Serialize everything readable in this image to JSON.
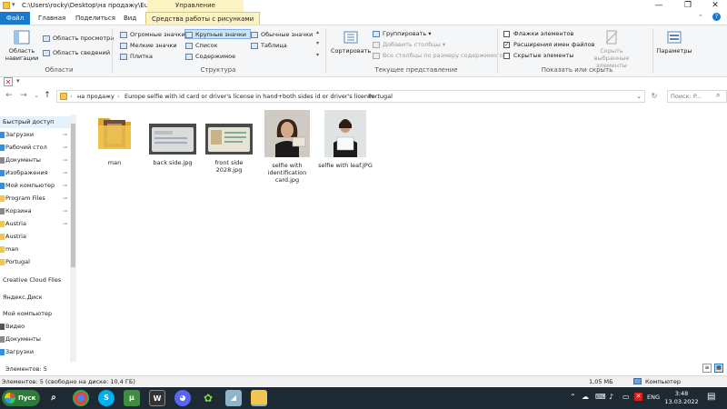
{
  "window": {
    "title": "C:\\Users\\rocky\\Desktop\\на продажу\\Europe...",
    "manage_label": "Управление",
    "minimize": "—",
    "maximize": "❐",
    "close": "✕"
  },
  "tabs": {
    "file": "Файл",
    "home": "Главная",
    "share": "Поделиться",
    "view": "Вид",
    "picture_tools": "Средства работы с рисунками"
  },
  "ribbon": {
    "areas": {
      "nav_pane": "Область навигации",
      "preview": "Область просмотра",
      "details": "Область сведений",
      "group_label": "Области"
    },
    "layout": {
      "huge": "Огромные значки",
      "large": "Крупные значки",
      "normal": "Обычные значки",
      "small": "Мелкие значки",
      "list": "Список",
      "table": "Таблица",
      "tiles": "Плитка",
      "content": "Содержимое",
      "group_label": "Структура"
    },
    "view": {
      "sort": "Сортировать",
      "group_by": "Группировать",
      "add_columns": "Добавить столбцы",
      "fit_columns": "Все столбцы по размеру содержимого",
      "group_label": "Текущее представление"
    },
    "show": {
      "checkboxes": "Флажки элементов",
      "extensions": "Расширения имен файлов",
      "hidden": "Скрытые элементы",
      "hide_selected": "Скрыть выбранные элементы",
      "group_label": "Показать или скрыть"
    },
    "options": "Параметры"
  },
  "address": {
    "crumbs": [
      "на продажу",
      "Europe selfie with id card or driver's license in hand+both sides id or driver's license",
      "Portugal"
    ],
    "separator": "›",
    "search_placeholder": "Поиск: P..."
  },
  "sidebar": {
    "items": [
      {
        "label": "Быстрый доступ",
        "pinned": false
      },
      {
        "label": "Загрузки",
        "pinned": true
      },
      {
        "label": "Рабочий стол",
        "pinned": true
      },
      {
        "label": "Документы",
        "pinned": true
      },
      {
        "label": "Изображения",
        "pinned": true
      },
      {
        "label": "Мой компьютер",
        "pinned": true
      },
      {
        "label": "Program Files",
        "pinned": true
      },
      {
        "label": "Корзина",
        "pinned": true
      },
      {
        "label": "Austria",
        "pinned": true
      },
      {
        "label": "Austria",
        "pinned": false
      },
      {
        "label": "man",
        "pinned": false
      },
      {
        "label": "Portugal",
        "pinned": false
      },
      {
        "label": "Creative Cloud Files",
        "pinned": false
      },
      {
        "label": "Яндекс.Диск",
        "pinned": false
      },
      {
        "label": "Мой компьютер",
        "pinned": false
      },
      {
        "label": "Видео",
        "pinned": false
      },
      {
        "label": "Документы",
        "pinned": false
      },
      {
        "label": "Загрузки",
        "pinned": false
      }
    ]
  },
  "files": [
    {
      "name": "man",
      "kind": "folder"
    },
    {
      "name": "back side.jpg",
      "kind": "id-card"
    },
    {
      "name": "front side 2028.jpg",
      "kind": "id-card"
    },
    {
      "name": "selfie with identification card.jpg",
      "kind": "photo"
    },
    {
      "name": "selfie with leaf.JPG",
      "kind": "photo"
    }
  ],
  "status": {
    "items_count": "Элементов: 5",
    "free_space": "Элементов: 5 (свободно на диске: 10,4 ГБ)",
    "size": "1,05 МБ",
    "location": "Компьютер"
  },
  "taskbar": {
    "start": "Пуск",
    "lang": "ENG",
    "time": "3:48",
    "date": "13.03.2022"
  },
  "colors": {
    "accent": "#1979ca",
    "manage": "#fcf3c2",
    "taskbar": "#1e2a33",
    "folder": "#f3c74f"
  }
}
